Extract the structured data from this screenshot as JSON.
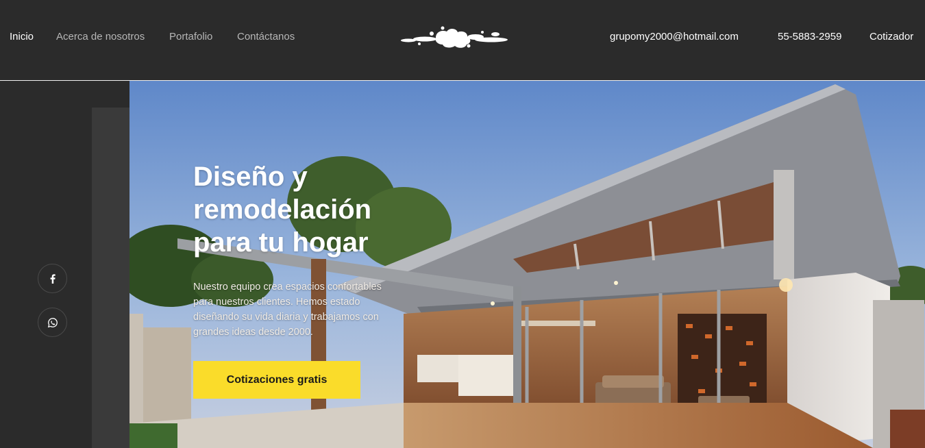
{
  "nav": {
    "left": [
      "Inicio",
      "Acerca de nosotros",
      "Portafolio",
      "Contáctanos"
    ],
    "right": [
      "grupomy2000@hotmail.com",
      "55-5883-2959",
      "Cotizador"
    ]
  },
  "logo": {
    "icon": "splash-logo"
  },
  "social": [
    {
      "icon": "facebook-icon"
    },
    {
      "icon": "whatsapp-icon"
    }
  ],
  "hero": {
    "title_line1": "Diseño y",
    "title_line2": "remodelación",
    "title_line3": "para tu hogar",
    "description": "Nuestro equipo crea espacios confortables para nuestros clientes. Hemos estado diseñando su vida diaria y trabajamos con grandes ideas desde 2000.",
    "cta_label": "Cotizaciones gratis"
  },
  "colors": {
    "background": "#2b2b2b",
    "accent": "#fadc2a",
    "nav_inactive": "#b7b7b7",
    "nav_active": "#ffffff"
  }
}
